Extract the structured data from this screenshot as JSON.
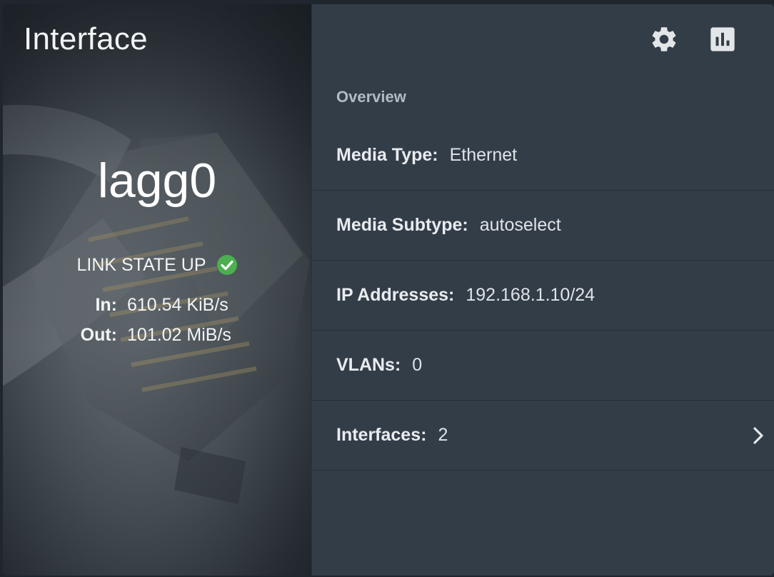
{
  "card": {
    "title": "Interface"
  },
  "status": {
    "name": "lagg0",
    "link_state": "LINK STATE UP",
    "in_label": "In:",
    "in_value": "610.54 KiB/s",
    "out_label": "Out:",
    "out_value": "101.02 MiB/s",
    "status_color": "#4caf50"
  },
  "toolbar": {
    "icons": [
      "gear-icon",
      "bar-chart-icon"
    ]
  },
  "overview": {
    "title": "Overview",
    "items": [
      {
        "label": "Media Type:",
        "value": "Ethernet"
      },
      {
        "label": "Media Subtype:",
        "value": "autoselect"
      },
      {
        "label": "IP Addresses:",
        "value": "192.168.1.10/24"
      },
      {
        "label": "VLANs:",
        "value": "0"
      },
      {
        "label": "Interfaces:",
        "value": "2"
      }
    ]
  }
}
